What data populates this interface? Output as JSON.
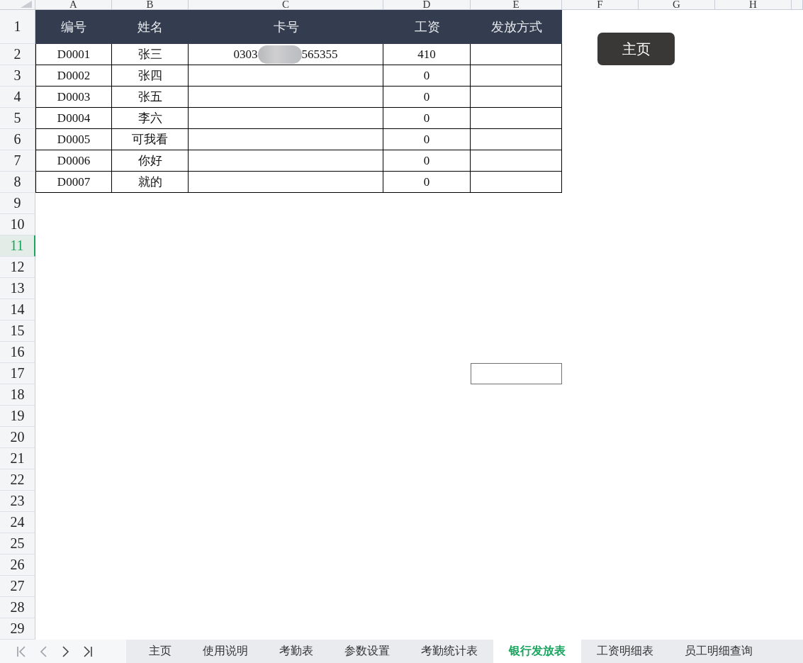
{
  "column_headers": [
    {
      "label": "A",
      "selected": false
    },
    {
      "label": "B",
      "selected": false
    },
    {
      "label": "C",
      "selected": false
    },
    {
      "label": "D",
      "selected": false
    },
    {
      "label": "E",
      "selected": false
    },
    {
      "label": "F",
      "selected": false
    },
    {
      "label": "G",
      "selected": false
    },
    {
      "label": "H",
      "selected": false
    }
  ],
  "row_headers": [
    {
      "label": "1",
      "selected": false
    },
    {
      "label": "2",
      "selected": false
    },
    {
      "label": "3",
      "selected": false
    },
    {
      "label": "4",
      "selected": false
    },
    {
      "label": "5",
      "selected": false
    },
    {
      "label": "6",
      "selected": false
    },
    {
      "label": "7",
      "selected": false
    },
    {
      "label": "8",
      "selected": false
    },
    {
      "label": "9",
      "selected": false
    },
    {
      "label": "10",
      "selected": false
    },
    {
      "label": "11",
      "selected": true
    },
    {
      "label": "12",
      "selected": false
    },
    {
      "label": "13",
      "selected": false
    },
    {
      "label": "14",
      "selected": false
    },
    {
      "label": "15",
      "selected": false
    },
    {
      "label": "16",
      "selected": false
    },
    {
      "label": "17",
      "selected": false
    },
    {
      "label": "18",
      "selected": false
    },
    {
      "label": "19",
      "selected": false
    },
    {
      "label": "20",
      "selected": false
    },
    {
      "label": "21",
      "selected": false
    },
    {
      "label": "22",
      "selected": false
    },
    {
      "label": "23",
      "selected": false
    },
    {
      "label": "24",
      "selected": false
    },
    {
      "label": "25",
      "selected": false
    },
    {
      "label": "26",
      "selected": false
    },
    {
      "label": "27",
      "selected": false
    },
    {
      "label": "28",
      "selected": false
    },
    {
      "label": "29",
      "selected": false
    }
  ],
  "table": {
    "columns": [
      "编号",
      "姓名",
      "卡号",
      "工资",
      "发放方式"
    ],
    "rows": [
      {
        "id": "D0001",
        "name": "张三",
        "card": {
          "start": "0303",
          "end": "565355",
          "redacted": true
        },
        "salary": "410"
      },
      {
        "id": "D0002",
        "name": "张四",
        "salary": "0"
      },
      {
        "id": "D0003",
        "name": "张五",
        "salary": "0"
      },
      {
        "id": "D0004",
        "name": "李六",
        "salary": "0"
      },
      {
        "id": "D0005",
        "name": "可我看",
        "salary": "0"
      },
      {
        "id": "D0006",
        "name": "你好",
        "salary": "0"
      },
      {
        "id": "D0007",
        "name": "就的",
        "salary": "0"
      }
    ]
  },
  "home_button": "主页",
  "sheet_tabs": [
    {
      "label": "主页",
      "selected": false
    },
    {
      "label": "使用说明",
      "selected": false
    },
    {
      "label": "考勤表",
      "selected": false
    },
    {
      "label": "参数设置",
      "selected": false
    },
    {
      "label": "考勤统计表",
      "selected": false
    },
    {
      "label": "银行发放表",
      "selected": true
    },
    {
      "label": "工资明细表",
      "selected": false
    },
    {
      "label": "员工明细查询",
      "selected": false
    }
  ]
}
